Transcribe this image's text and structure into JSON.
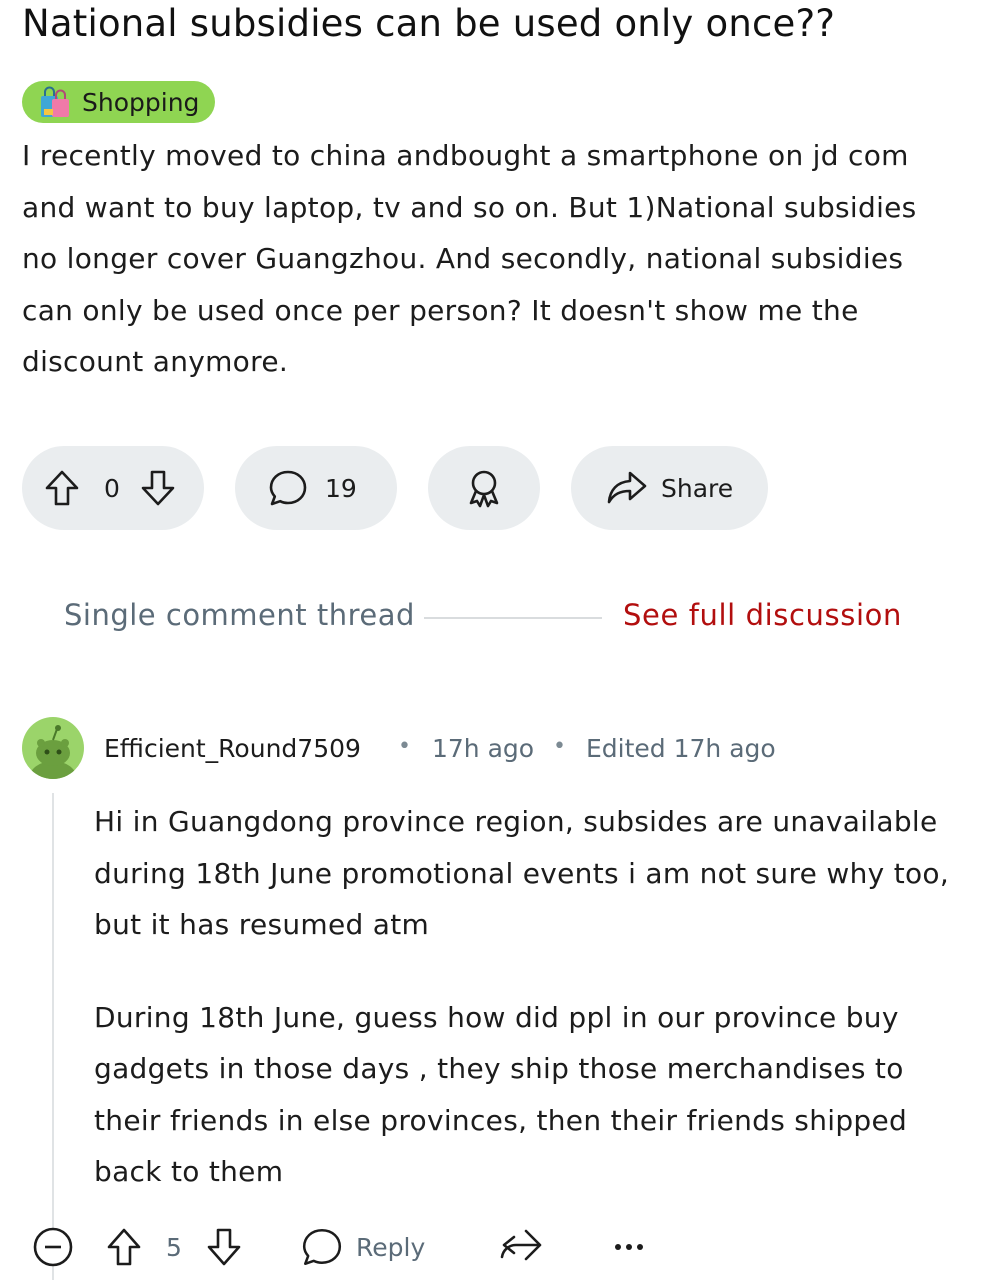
{
  "post": {
    "title": "National subsidies can be used only once??",
    "flair": {
      "label": "Shopping",
      "icon": "shopping-bags-icon",
      "color": "#8fd552"
    },
    "body": "I recently moved to china andbought a smartphone on jd com and want to buy laptop, tv and so on. But 1)National subsidies no longer cover Guangzhou. And secondly, national subsidies can only be used once per person? It doesn't show me the discount anymore.",
    "votes": "0",
    "comments": "19",
    "share_label": "Share"
  },
  "thread": {
    "label": "Single comment thread",
    "see_full_label": "See full discussion",
    "see_full_color": "#b20e0e"
  },
  "comment": {
    "author": "Efficient_Round7509",
    "time": "17h ago",
    "edited": "Edited 17h ago",
    "paragraphs": [
      "Hi in Guangdong province region, subsides are unavailable during 18th June promotional events i am not sure why too, but it has resumed atm",
      "During 18th June, guess how did ppl in our province buy gadgets in those days , they ship those merchandises to their friends in else provinces, then their friends shipped back to them"
    ],
    "votes": "5",
    "reply_label": "Reply"
  }
}
